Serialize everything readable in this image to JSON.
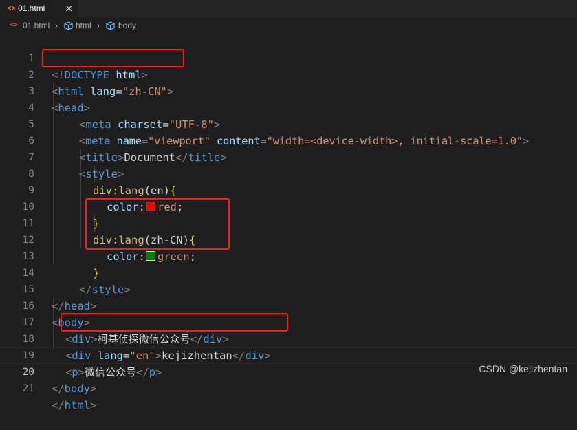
{
  "tab": {
    "icon": "<>",
    "name": "01.html",
    "close": "×"
  },
  "breadcrumb": {
    "file": "01.html",
    "sep1": "›",
    "html": "html",
    "sep2": "›",
    "body": "body"
  },
  "line_numbers": [
    "1",
    "2",
    "3",
    "4",
    "5",
    "6",
    "7",
    "8",
    "9",
    "10",
    "11",
    "12",
    "13",
    "14",
    "15",
    "16",
    "17",
    "18",
    "19",
    "20",
    "21"
  ],
  "code": {
    "l1": [
      "<!",
      "DOCTYPE",
      " ",
      "html",
      ">"
    ],
    "l2": [
      "<",
      "html",
      " ",
      "lang",
      "=",
      "\"zh-CN\"",
      ">"
    ],
    "l3": [
      "<",
      "head",
      ">"
    ],
    "l4": [
      "<",
      "meta",
      " ",
      "charset",
      "=",
      "\"UTF-8\"",
      ">"
    ],
    "l5": [
      "<",
      "meta",
      " ",
      "name",
      "=",
      "\"viewport\"",
      " ",
      "content",
      "=",
      "\"width=<device-width>, initial-scale=1.0\"",
      ">"
    ],
    "l6": [
      "<",
      "title",
      ">",
      "Document",
      "</",
      "title",
      ">"
    ],
    "l7": [
      "<",
      "style",
      ">"
    ],
    "l8": [
      "div:lang",
      "(",
      "en",
      ")",
      "{"
    ],
    "l9": [
      "color",
      ":",
      "red",
      ";"
    ],
    "l10": [
      "}"
    ],
    "l11": [
      "div:lang",
      "(",
      "zh-CN",
      ")",
      "{"
    ],
    "l12": [
      "color",
      ":",
      "green",
      ";"
    ],
    "l13": [
      "}"
    ],
    "l14": [
      "</",
      "style",
      ">"
    ],
    "l15": [
      "</",
      "head",
      ">"
    ],
    "l16": [
      "<",
      "body",
      ">"
    ],
    "l17": [
      "<",
      "div",
      ">",
      "柯基侦探微信公众号",
      "</",
      "div",
      ">"
    ],
    "l18": [
      "<",
      "div",
      " ",
      "lang",
      "=",
      "\"en\"",
      ">",
      "kejizhentan",
      "</",
      "div",
      ">"
    ],
    "l19": [
      "<",
      "p",
      ">",
      "微信公众号",
      "</",
      "p",
      ">"
    ],
    "l20": [
      "</",
      "body",
      ">"
    ],
    "l21": [
      "</",
      "html",
      ">"
    ]
  },
  "swatch_colors": {
    "red": "#ff0000",
    "green": "#008000"
  },
  "annotation_color": "#ff1a1a",
  "watermark": "CSDN @kejizhentan"
}
